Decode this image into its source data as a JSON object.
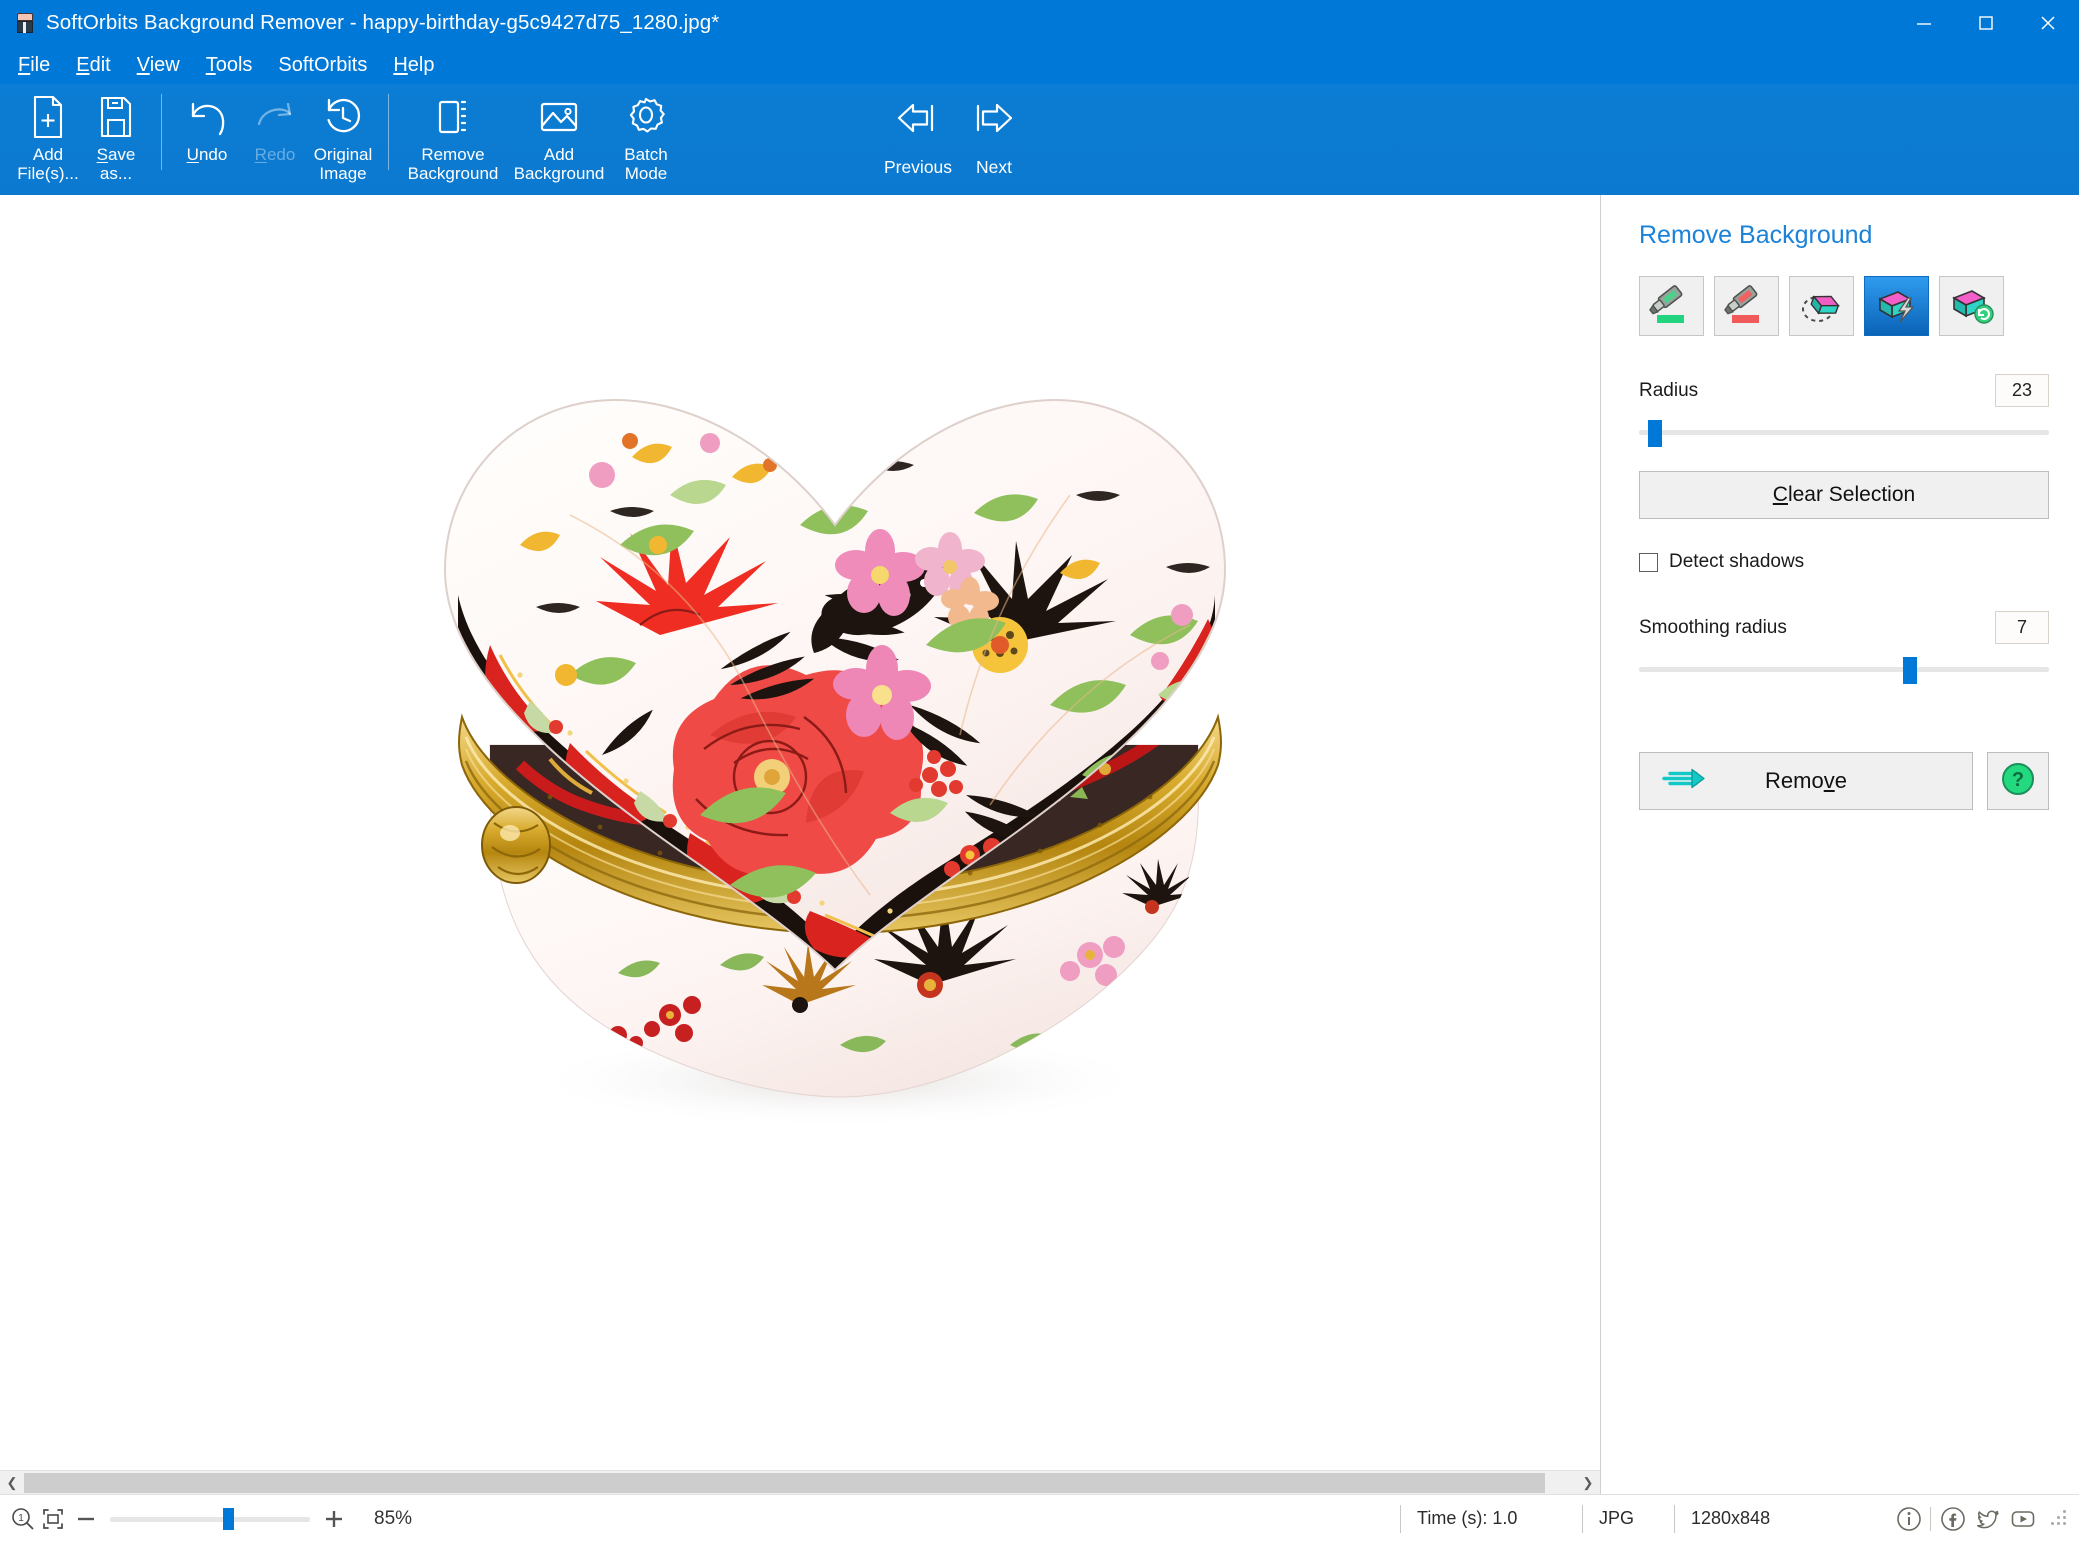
{
  "window": {
    "title": "SoftOrbits Background Remover - happy-birthday-g5c9427d75_1280.jpg*",
    "app_icon": "app-logo-icon",
    "minimize": "minimize-icon",
    "maximize": "maximize-icon",
    "close": "close-icon",
    "accent_color": "#0078d7"
  },
  "menubar": {
    "items": [
      {
        "mnemonic": "F",
        "rest": "ile"
      },
      {
        "mnemonic": "E",
        "rest": "dit"
      },
      {
        "mnemonic": "V",
        "rest": "iew"
      },
      {
        "mnemonic": "T",
        "rest": "ools"
      },
      {
        "mnemonic": "",
        "rest": "SoftOrbits"
      },
      {
        "mnemonic": "H",
        "rest": "elp"
      }
    ]
  },
  "toolbar": {
    "buttons": [
      {
        "name": "add-files",
        "icon": "add-file-icon",
        "line1": "Add",
        "line2": "File(s)...",
        "mnemonic": "i",
        "disabled": false
      },
      {
        "name": "save-as",
        "icon": "save-disk-icon",
        "line1": "Save",
        "line2": "as...",
        "mnemonic": "S",
        "disabled": false
      },
      {
        "name": "undo",
        "icon": "undo-arrow-icon",
        "line1": "Undo",
        "line2": "",
        "mnemonic": "U",
        "disabled": false
      },
      {
        "name": "redo",
        "icon": "redo-arrow-icon",
        "line1": "Redo",
        "line2": "",
        "mnemonic": "R",
        "disabled": true
      },
      {
        "name": "original-image",
        "icon": "history-clock-icon",
        "line1": "Original",
        "line2": "Image",
        "mnemonic": "",
        "disabled": false
      },
      {
        "name": "remove-background",
        "icon": "cutout-rect-icon",
        "line1": "Remove",
        "line2": "Background",
        "mnemonic": "",
        "disabled": false
      },
      {
        "name": "add-background",
        "icon": "picture-icon",
        "line1": "Add",
        "line2": "Background",
        "mnemonic": "",
        "disabled": false
      },
      {
        "name": "batch-mode",
        "icon": "gear-icon",
        "line1": "Batch",
        "line2": "Mode",
        "mnemonic": "",
        "disabled": false
      }
    ],
    "nav": [
      {
        "name": "previous",
        "icon": "arrow-left-bar-icon",
        "label": "Previous"
      },
      {
        "name": "next",
        "icon": "arrow-right-bar-icon",
        "label": "Next"
      }
    ]
  },
  "panel": {
    "title": "Remove Background",
    "tools": [
      {
        "name": "mark-keep-marker",
        "icon": "green-marker-icon",
        "active": false
      },
      {
        "name": "mark-remove-marker",
        "icon": "red-marker-icon",
        "active": false
      },
      {
        "name": "eraser-selection",
        "icon": "eraser-dashed-icon",
        "active": false
      },
      {
        "name": "magic-wand-auto",
        "icon": "auto-lightning-icon",
        "active": true
      },
      {
        "name": "refresh-selection",
        "icon": "refresh-selection-icon",
        "active": false
      }
    ],
    "radius": {
      "label": "Radius",
      "value": "23",
      "percent": 4
    },
    "clear_selection": {
      "label_mnemonic": "C",
      "label_rest": "lear Selection"
    },
    "detect_shadows": {
      "label": "Detect shadows",
      "checked": false
    },
    "smoothing_radius": {
      "label": "Smoothing radius",
      "value": "7",
      "percent": 66
    },
    "remove": {
      "icon": "arrow-right-teal-icon",
      "label_pre": "Remo",
      "label_mnemonic": "v",
      "label_post": "e"
    },
    "help": {
      "icon": "help-question-icon"
    }
  },
  "canvas": {
    "scroll_left_arrow": "chevron-left-icon",
    "scroll_right_arrow": "chevron-right-icon",
    "image_alt": "heart-shaped-porcelain-trinket-box"
  },
  "statusbar": {
    "zoom_fit_icon": "zoom-one-to-one-icon",
    "fit_screen_icon": "fit-to-screen-icon",
    "minus": "−",
    "plus": "+",
    "zoom_percent": "85%",
    "time_label": "Time (s): 1.0",
    "format": "JPG",
    "dimensions": "1280x848",
    "social": [
      {
        "name": "info-icon",
        "glyph": "i"
      },
      {
        "name": "facebook-icon",
        "glyph": "f"
      },
      {
        "name": "twitter-icon",
        "glyph": "t"
      },
      {
        "name": "youtube-icon",
        "glyph": "y"
      }
    ]
  }
}
